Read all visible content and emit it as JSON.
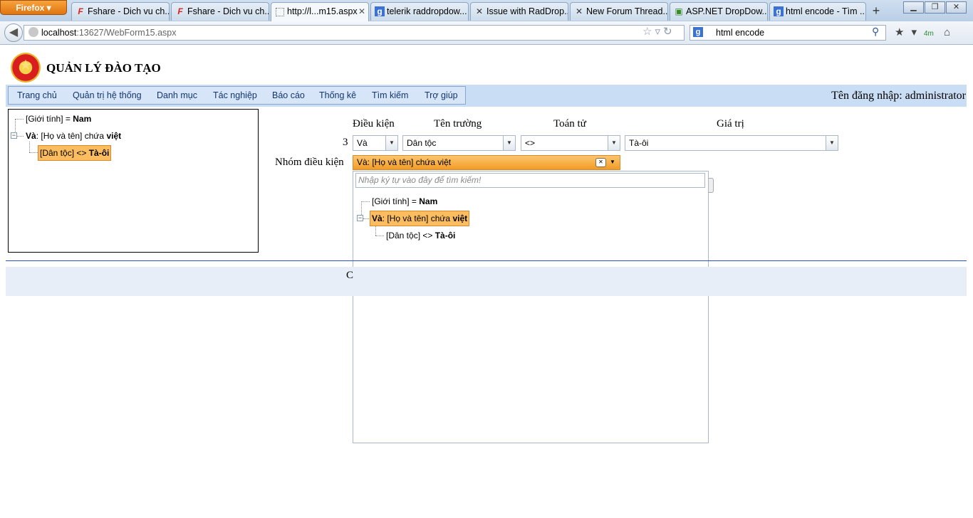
{
  "browser": {
    "menu_button": "Firefox",
    "tabs": [
      {
        "label": "Fshare - Dich vu ch...",
        "icon": "F"
      },
      {
        "label": "Fshare - Dich vu ch...",
        "icon": "F"
      },
      {
        "label": "http://l...m15.aspx",
        "icon": ""
      },
      {
        "label": "telerik raddropdow...",
        "icon": "g"
      },
      {
        "label": "Issue with RadDrop...",
        "icon": "✕"
      },
      {
        "label": "New Forum Thread...",
        "icon": "✕"
      },
      {
        "label": "ASP.NET DropDow...",
        "icon": "▣"
      },
      {
        "label": "html encode - Tìm ...",
        "icon": "g"
      }
    ],
    "url_host": "localhost",
    "url_path": ":13627/WebForm15.aspx",
    "search_text": "html encode",
    "addon_badge": "4m"
  },
  "site": {
    "title": "QUẢN LÝ ĐÀO TẠO",
    "menu": [
      "Trang chủ",
      "Quản trị hệ thống",
      "Danh mục",
      "Tác nghiệp",
      "Báo cáo",
      "Thống kê",
      "Tìm kiếm",
      "Trợ giúp"
    ],
    "login": "Tên đăng nhập: administrator"
  },
  "tree": {
    "n1_prefix": "[Giới tính] = ",
    "n1_value": "Nam",
    "n2_op": "Và",
    "n2_text": ": [Họ và tên] chứa ",
    "n2_value": "việt",
    "n3_prefix": "[Dân tộc] <> ",
    "n3_value": "Tà-ôi"
  },
  "form": {
    "headers": {
      "condition": "Điều kiện",
      "field": "Tên trường",
      "operator": "Toán tử",
      "value": "Giá trị"
    },
    "row_number": "3",
    "condition_value": "Và",
    "field_value": "Dân tộc",
    "operator_value": "<>",
    "value_value": "Tà-ôi",
    "group_label": "Nhóm điều kiện",
    "group_value": "Và: [Họ và tên] chứa việt",
    "search_placeholder": "Nhập ký tự vào đây để tìm kiếm!"
  },
  "footer": {
    "text": "C"
  }
}
